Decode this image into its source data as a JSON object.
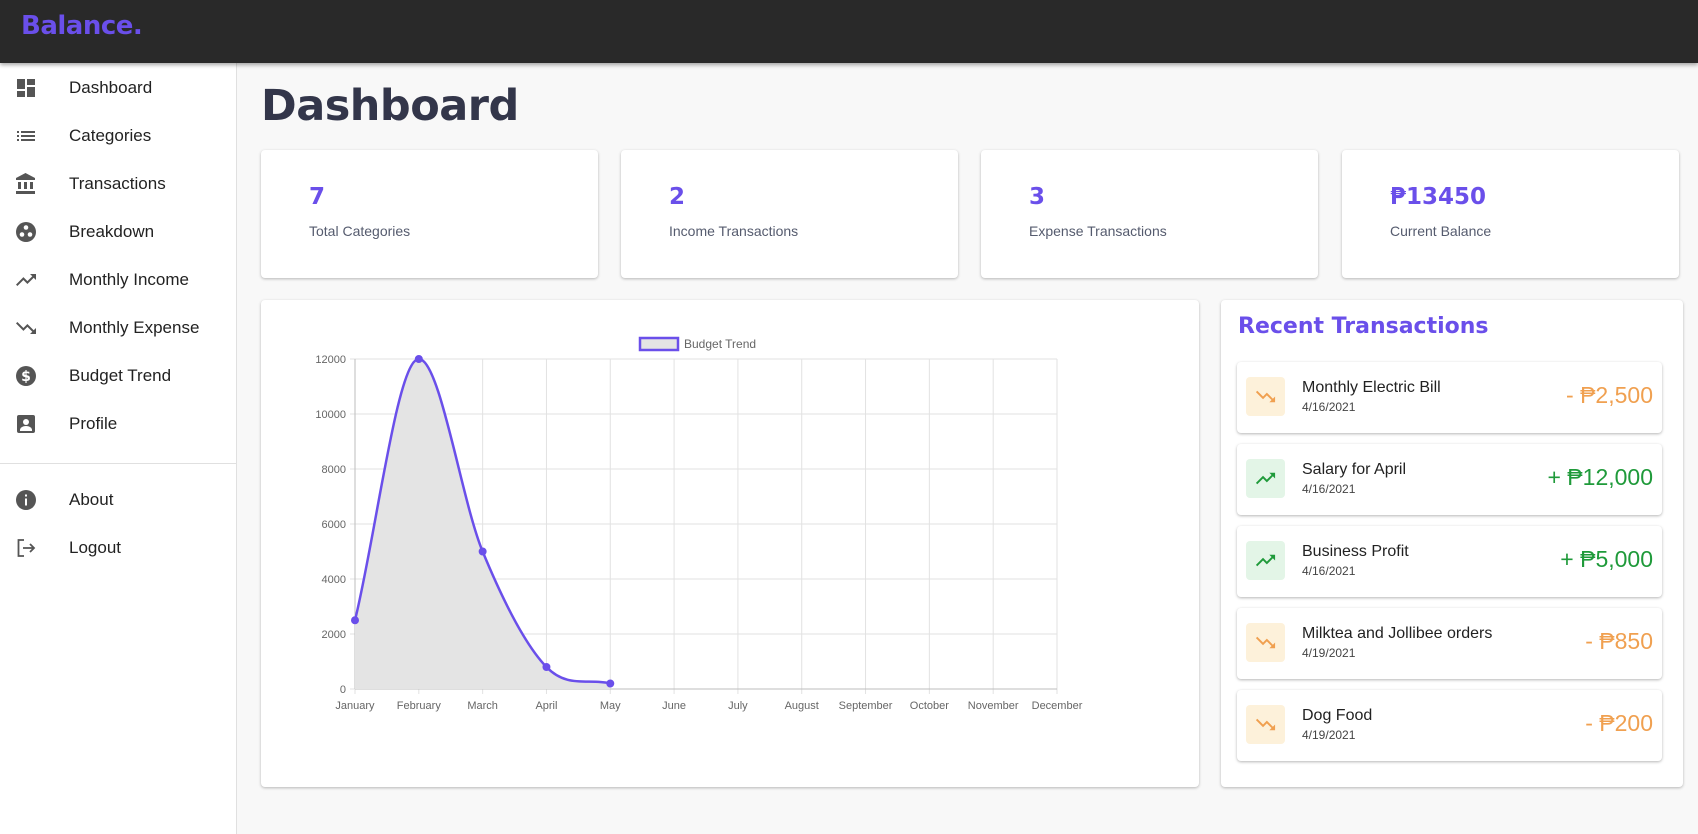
{
  "brand": "Balance.",
  "sidebar": {
    "items": [
      {
        "label": "Dashboard",
        "icon": "dashboard-icon"
      },
      {
        "label": "Categories",
        "icon": "list-icon"
      },
      {
        "label": "Transactions",
        "icon": "bank-icon"
      },
      {
        "label": "Breakdown",
        "icon": "breakdown-icon"
      },
      {
        "label": "Monthly Income",
        "icon": "trending-up-icon"
      },
      {
        "label": "Monthly Expense",
        "icon": "trending-down-icon"
      },
      {
        "label": "Budget Trend",
        "icon": "dollar-icon"
      },
      {
        "label": "Profile",
        "icon": "profile-icon"
      }
    ],
    "secondary": [
      {
        "label": "About",
        "icon": "info-icon"
      },
      {
        "label": "Logout",
        "icon": "logout-icon"
      }
    ]
  },
  "page": {
    "title": "Dashboard"
  },
  "stats": [
    {
      "value": "7",
      "label": "Total Categories"
    },
    {
      "value": "2",
      "label": "Income Transactions"
    },
    {
      "value": "3",
      "label": "Expense Transactions"
    },
    {
      "value": "₱13450",
      "label": "Current Balance"
    }
  ],
  "chart_data": {
    "type": "line",
    "x": [
      "January",
      "February",
      "March",
      "April",
      "May",
      "June",
      "July",
      "August",
      "September",
      "October",
      "November",
      "December"
    ],
    "series": [
      {
        "name": "Budget Trend",
        "values": [
          2500,
          12000,
          5000,
          800,
          200
        ]
      }
    ],
    "yticks": [
      0,
      2000,
      4000,
      6000,
      8000,
      10000,
      12000
    ],
    "ylim": [
      0,
      12000
    ],
    "grid": true,
    "legend": "top-center",
    "fill": "area",
    "colors": {
      "line": "#6a4fea",
      "fill": "#e4e4e4"
    }
  },
  "transactions": {
    "title": "Recent Transactions",
    "items": [
      {
        "name": "Monthly Electric Bill",
        "date": "4/16/2021",
        "amount": "- ₱2,500",
        "type": "expense"
      },
      {
        "name": "Salary for April",
        "date": "4/16/2021",
        "amount": "+ ₱12,000",
        "type": "income"
      },
      {
        "name": "Business Profit",
        "date": "4/16/2021",
        "amount": "+ ₱5,000",
        "type": "income"
      },
      {
        "name": "Milktea and Jollibee orders",
        "date": "4/19/2021",
        "amount": "- ₱850",
        "type": "expense"
      },
      {
        "name": "Dog Food",
        "date": "4/19/2021",
        "amount": "- ₱200",
        "type": "expense"
      }
    ]
  },
  "colors": {
    "accent": "#6a4fea",
    "income": "#1f9a3a",
    "expense": "#f0a050",
    "topbar": "#292929"
  }
}
